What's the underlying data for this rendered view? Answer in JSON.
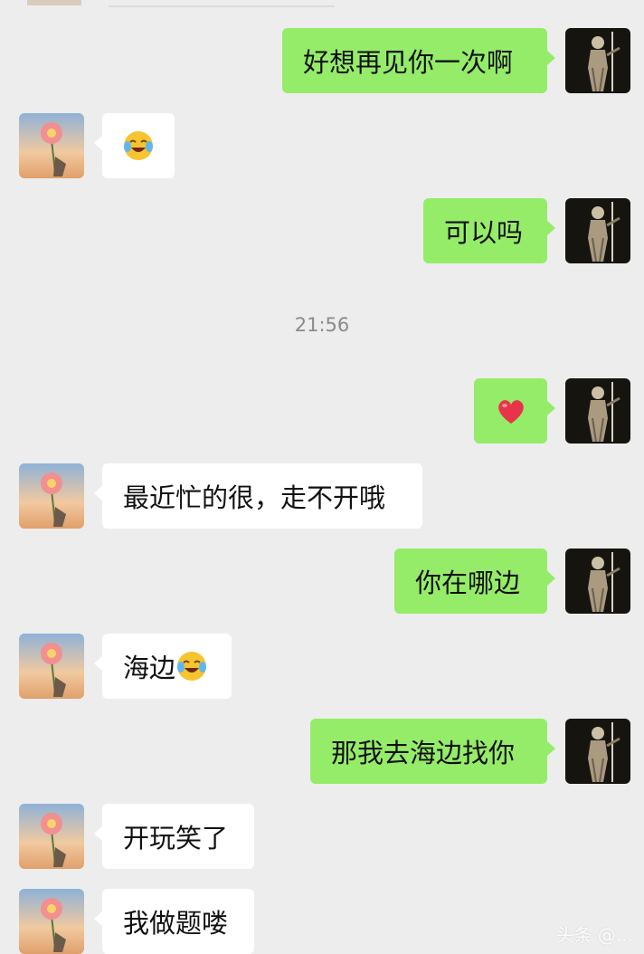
{
  "chat": {
    "timestamp": "21:56",
    "watermark": "头条 @...",
    "messages": [
      {
        "side": "right",
        "text": "好想再见你一次啊"
      },
      {
        "side": "left",
        "emoji": "face-with-tears-of-joy-icon"
      },
      {
        "side": "right",
        "text": "可以吗"
      },
      {
        "side": "right",
        "emoji": "red-heart-icon"
      },
      {
        "side": "left",
        "text": "最近忙的很，走不开哦"
      },
      {
        "side": "right",
        "text": "你在哪边"
      },
      {
        "side": "left",
        "text": "海边",
        "emoji_after": "face-with-tears-of-joy-icon"
      },
      {
        "side": "right",
        "text": "那我去海边找你"
      },
      {
        "side": "left",
        "text": "开玩笑了"
      },
      {
        "side": "left",
        "text": "我做题喽"
      }
    ]
  },
  "colors": {
    "background": "#ededed",
    "sent_bubble": "#95ec69",
    "received_bubble": "#ffffff",
    "timestamp_text": "#8a8a8a"
  }
}
